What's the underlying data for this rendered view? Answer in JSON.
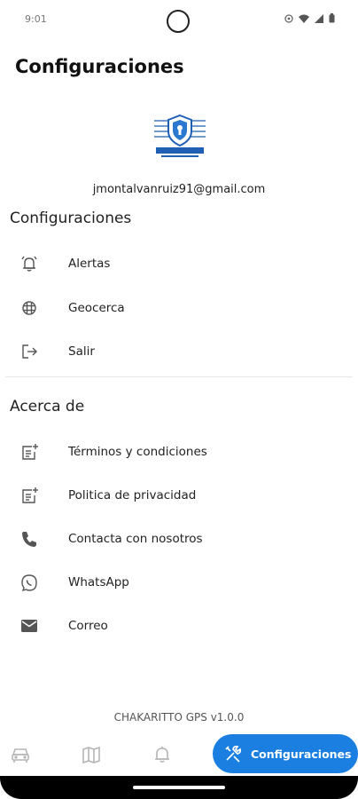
{
  "status_bar": {
    "time": "9:01"
  },
  "page_title": "Configuraciones",
  "account": {
    "email": "jmontalvanruiz91@gmail.com"
  },
  "sections": {
    "settings": {
      "title": "Configuraciones",
      "items": [
        {
          "label": "Alertas",
          "icon": "alarm-bell-icon"
        },
        {
          "label": "Geocerca",
          "icon": "grid-globe-icon"
        },
        {
          "label": "Salir",
          "icon": "logout-icon"
        }
      ]
    },
    "about": {
      "title": "Acerca de",
      "items": [
        {
          "label": "Términos y condiciones",
          "icon": "document-add-icon"
        },
        {
          "label": "Politica de privacidad",
          "icon": "document-add-icon"
        },
        {
          "label": "Contacta con nosotros",
          "icon": "phone-icon"
        },
        {
          "label": "WhatsApp",
          "icon": "whatsapp-icon"
        },
        {
          "label": "Correo",
          "icon": "mail-icon"
        }
      ]
    }
  },
  "footer": {
    "version": "CHAKARITTO GPS v1.0.0"
  },
  "bottom_nav": {
    "items": [
      {
        "icon": "car-icon"
      },
      {
        "icon": "map-icon"
      },
      {
        "icon": "bell-icon"
      }
    ],
    "active": {
      "label": "Configuraciones",
      "icon": "tools-icon"
    }
  },
  "colors": {
    "accent": "#1a7fe0",
    "text": "#222222",
    "icon": "#555555"
  }
}
